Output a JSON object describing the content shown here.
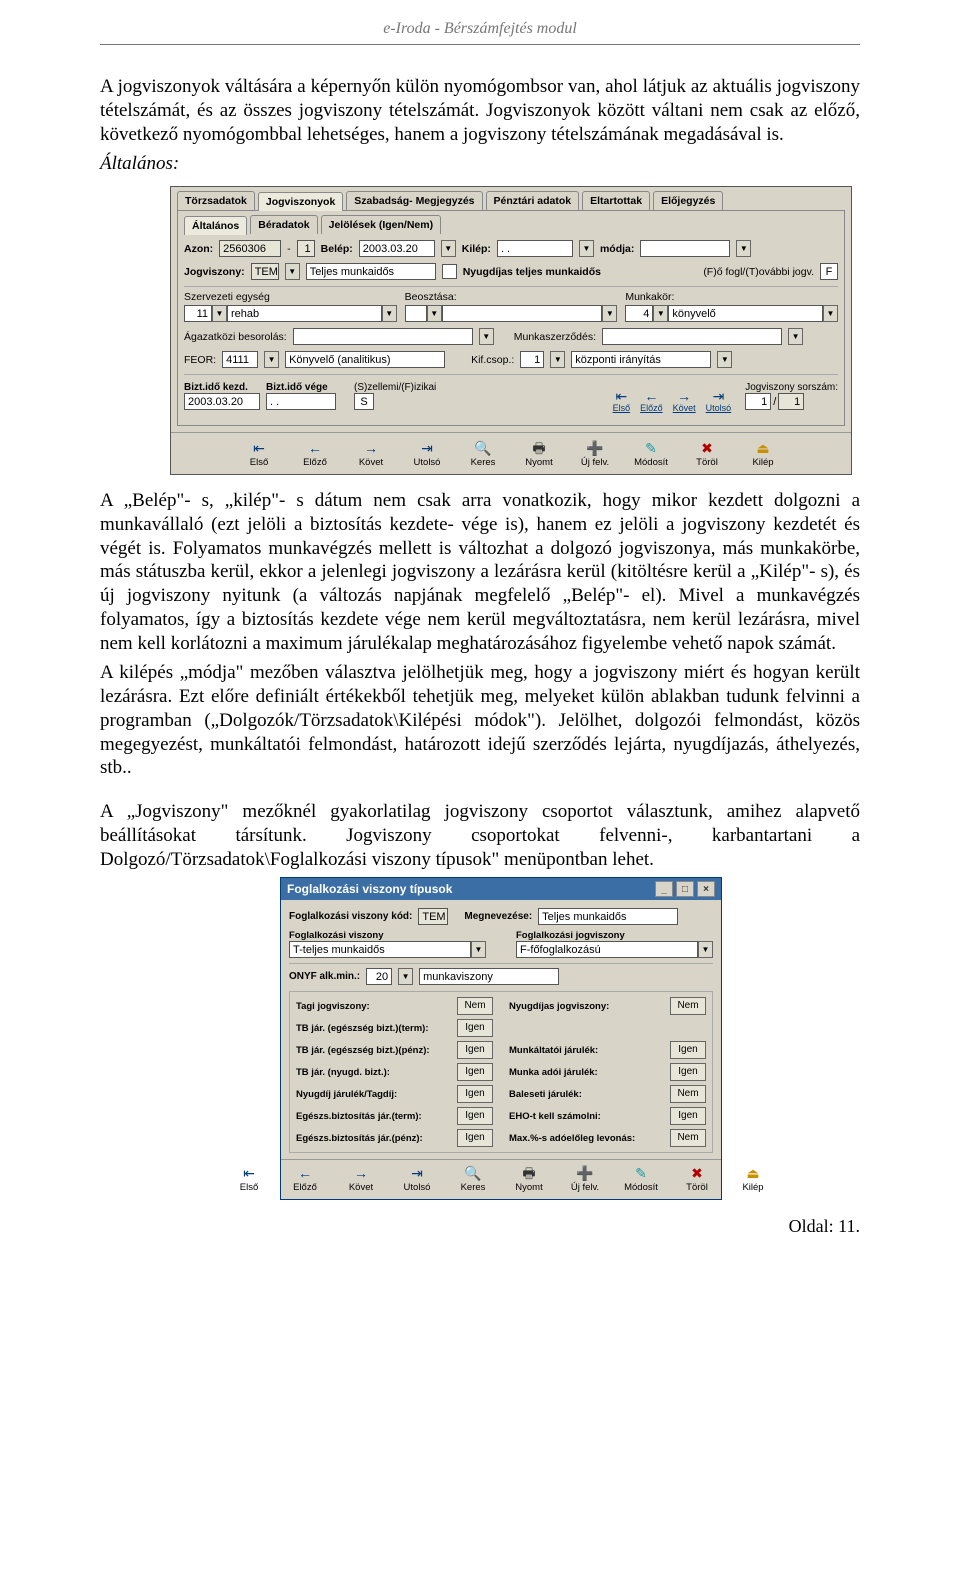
{
  "header": {
    "title": "e-Iroda - Bérszámfejtés modul"
  },
  "paragraphs": {
    "p1": "A jogviszonyok váltására a képernyőn külön nyomógombsor van, ahol látjuk az aktuális jogviszony tételszámát, és az összes jogviszony tételszámát. Jogviszonyok között váltani nem csak az előző, következő nyomógombbal lehetséges, hanem a jogviszony tételszámának megadásával is.",
    "altalanos": "Általános:",
    "p2": "A „Belép\"- s, „kilép\"- s dátum nem csak arra vonatkozik, hogy mikor kezdett dolgozni a munkavállaló (ezt jelöli a biztosítás kezdete- vége is), hanem ez jelöli a jogviszony kezdetét és végét is. Folyamatos munkavégzés mellett is változhat a dolgozó jogviszonya, más munkakörbe, más státuszba kerül, ekkor a jelenlegi jogviszony a lezárásra kerül (kitöltésre kerül a „Kilép\"- s), és új jogviszony nyitunk (a változás napjának megfelelő „Belép\"- el). Mivel a munkavégzés folyamatos, így a biztosítás kezdete vége nem kerül megváltoztatásra, nem kerül lezárásra, mivel nem kell korlátozni a maximum járulékalap meghatározásához figyelembe vehető napok számát.",
    "p3": "A kilépés „módja\" mezőben választva jelölhetjük meg, hogy a jogviszony miért és hogyan került lezárásra. Ezt előre definiált értékekből tehetjük meg, melyeket külön ablakban tudunk felvinni a programban („Dolgozók/Törzsadatok\\Kilépési módok\"). Jelölhet, dolgozói felmondást, közös megegyezést, munkáltatói felmondást, határozott idejű szerződés lejárta, nyugdíjazás, áthelyezés, stb..",
    "p4": "A „Jogviszony\" mezőknél gyakorlatilag jogviszony csoportot választunk, amihez alapvető beállításokat társítunk. Jogviszony csoportokat felvenni-, karbantartani a Dolgozó/Törzsadatok\\Foglalkozási viszony típusok\" menüpontban lehet."
  },
  "win1": {
    "tabs": [
      "Törzsadatok",
      "Jogviszonyok",
      "Szabadság- Megjegyzés",
      "Pénztári adatok",
      "Eltartottak",
      "Előjegyzés"
    ],
    "subtabs": [
      "Általános",
      "Béradatok",
      "Jelölések (Igen/Nem)"
    ],
    "r1": {
      "azon": "Azon:",
      "azon_v": "2560306",
      "dash": "-",
      "one": "1",
      "belep": "Belép:",
      "belep_v": "2003.03.20",
      "kilep": "Kilép:",
      "kilep_v": ".  .",
      "modja": "módja:"
    },
    "r2": {
      "jogv": "Jogviszony:",
      "code": "TEM",
      "desc": "Teljes munkaidős",
      "nyug": "Nyugdíjas teljes munkaidős",
      "ff": "(F)ő fogl/(T)ovábbi jogv.",
      "ff_v": "F"
    },
    "r3": {
      "sz": "Szervezeti egység",
      "sz_n": "11",
      "sz_v": "rehab",
      "be": "Beosztása:",
      "mk": "Munkakör:",
      "mk_n": "4",
      "mk_v": "könyvelő"
    },
    "r4": {
      "ag": "Ágazatközi besorolás:",
      "msz": "Munkaszerződés:"
    },
    "r5": {
      "feor": "FEOR:",
      "feor_n": "4111",
      "feor_v": "Könyvelő (analitikus)",
      "kif": "Kif.csop.:",
      "kif_n": "1",
      "kif_v": "központi irányítás"
    },
    "r6": {
      "bk": "Bizt.idő kezd.",
      "bk_v": "2003.03.20",
      "bv": "Bizt.idő vége",
      "bv_v": ".  .",
      "sf": "(S)zellemi/(F)izikai",
      "sf_v": "S",
      "js": "Jogviszony sorszám:",
      "js_v1": "1",
      "js_v2": "1"
    },
    "nav": [
      "Első",
      "Előző",
      "Követ",
      "Utolsó"
    ],
    "toolbar": [
      {
        "sym": "⇤",
        "cls": "ic-blue",
        "txt": "Első",
        "k": "E"
      },
      {
        "sym": "←",
        "cls": "ic-blue",
        "txt": "Előző",
        "k": "l"
      },
      {
        "sym": "→",
        "cls": "ic-blue",
        "txt": "Követ",
        "k": "K"
      },
      {
        "sym": "⇥",
        "cls": "ic-blue",
        "txt": "Utolsó",
        "k": "U"
      },
      {
        "sym": "🔍",
        "cls": "ic-green",
        "txt": "Keres",
        "k": "r"
      },
      {
        "sym": "🖶",
        "cls": "ic-dark",
        "txt": "Nyomt",
        "k": "N"
      },
      {
        "sym": "➕",
        "cls": "ic-mag",
        "txt": "Új felv.",
        "k": "Ú"
      },
      {
        "sym": "✎",
        "cls": "ic-cyan",
        "txt": "Módosít",
        "k": "M"
      },
      {
        "sym": "✖",
        "cls": "ic-red",
        "txt": "Töröl",
        "k": "T"
      },
      {
        "sym": "⏏",
        "cls": "ic-yellow",
        "txt": "Kilép",
        "k": "i"
      }
    ]
  },
  "dlg": {
    "title": "Foglalkozási viszony típusok",
    "r1": {
      "kod": "Foglalkozási viszony kód:",
      "kod_v": "TEM",
      "meg": "Megnevezése:",
      "meg_v": "Teljes munkaidős"
    },
    "r2": {
      "fv": "Foglalkozási viszony",
      "fv_v": "T-teljes munkaidős",
      "fj": "Foglalkozási jogviszony",
      "fj_v": "F-főfoglalkozású"
    },
    "r3": {
      "onyf": "ONYF alk.min.:",
      "onyf_n": "20",
      "onyf_v": "munkaviszony"
    },
    "grid": [
      {
        "l": "Tagi jogviszony:",
        "v": "Nem"
      },
      {
        "l": "Nyugdíjas jogviszony:",
        "v": "Nem"
      },
      {
        "l": "TB jár. (egészség bizt.)(term):",
        "v": "Igen"
      },
      {
        "l": "",
        "v": ""
      },
      {
        "l": "TB jár. (egészség bizt.)(pénz):",
        "v": "Igen"
      },
      {
        "l": "Munkáltatói járulék:",
        "v": "Igen"
      },
      {
        "l": "TB jár. (nyugd. bizt.):",
        "v": "Igen"
      },
      {
        "l": "Munka adói járulék:",
        "v": "Igen"
      },
      {
        "l": "Nyugdíj járulék/Tagdíj:",
        "v": "Igen"
      },
      {
        "l": "Baleseti járulék:",
        "v": "Nem"
      },
      {
        "l": "Egészs.biztosítás jár.(term):",
        "v": "Igen"
      },
      {
        "l": "EHO-t kell számolni:",
        "v": "Igen"
      },
      {
        "l": "Egészs.biztosítás jár.(pénz):",
        "v": "Igen"
      },
      {
        "l": "Max.%-s adóelőleg levonás:",
        "v": "Nem"
      }
    ]
  },
  "footer": {
    "page": "Oldal: 11."
  }
}
